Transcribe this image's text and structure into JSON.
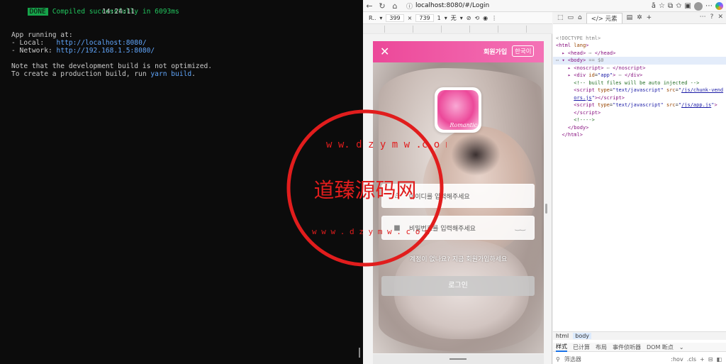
{
  "terminal": {
    "done_badge": "DONE",
    "compiled": "Compiled successfully in 6093ms",
    "time": "14:24:11",
    "app_running": "App running at:",
    "local_label": "- Local:   ",
    "local_url": "http://localhost:8080/",
    "network_label": "- Network: ",
    "network_url": "http://192.168.1.5:8080/",
    "note1": "Note that the development build is not optimized.",
    "note2_prefix": "To create a production build, run ",
    "note2_cmd": "yarn build",
    "note2_suffix": "."
  },
  "browser": {
    "url_host": "localhost",
    "url_path": ":8080/#/Login",
    "device": "R..",
    "width": "399",
    "height": "739",
    "zoom": "1",
    "throttle": "无"
  },
  "phone": {
    "signup": "회원가입",
    "lang": "한국이",
    "logo_text": "Romantic",
    "username_placeholder": "아이디를 입력해주세요",
    "password_placeholder": "비밀번호를 입력해주세요",
    "hint": "계정이 없나요? 지금 회원가입하세요",
    "login": "로그인"
  },
  "devtools": {
    "tab_elements": "元素",
    "dom_doctype": "<!DOCTYPE html>",
    "breadcrumb_html": "html",
    "breadcrumb_body": "body",
    "tab_styles": "样式",
    "tab_computed": "已计算",
    "tab_layout": "布局",
    "tab_listeners": "事件侦听器",
    "tab_dom_breakpoints": "DOM 断点",
    "filter": "筛选器",
    "hov": ":hov",
    "cls": ".cls"
  },
  "watermark": {
    "text": "道臻源码网",
    "ring": "www.dzymw.com"
  },
  "colors": {
    "accent_pink": "#ec4899",
    "terminal_green": "#22c55e",
    "link_blue": "#60a5fa"
  }
}
